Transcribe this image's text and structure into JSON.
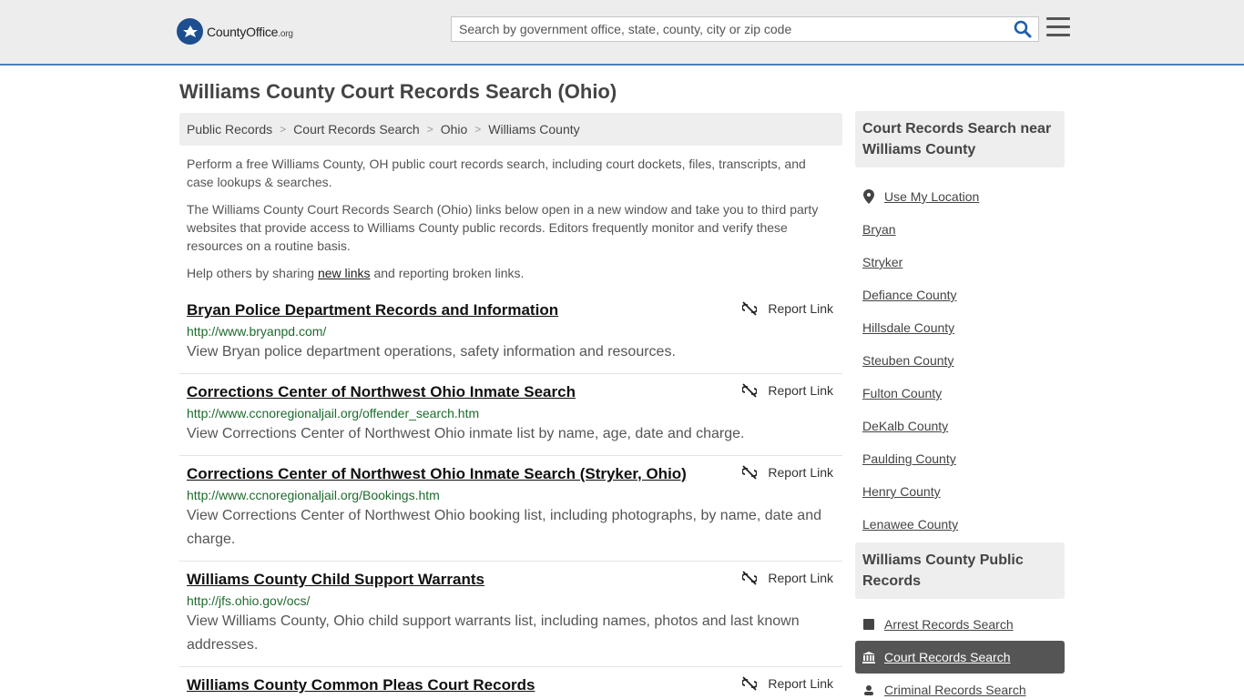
{
  "header": {
    "logo_text_main": "CountyOffice",
    "logo_text_org": ".org",
    "search_placeholder": "Search by government office, state, county, city or zip code"
  },
  "page_title": "Williams County Court Records Search (Ohio)",
  "breadcrumb": [
    {
      "label": "Public Records"
    },
    {
      "label": "Court Records Search"
    },
    {
      "label": "Ohio"
    },
    {
      "label": "Williams County"
    }
  ],
  "intro": {
    "p1": "Perform a free Williams County, OH public court records search, including court dockets, files, transcripts, and case lookups & searches.",
    "p2": "The Williams County Court Records Search (Ohio) links below open in a new window and take you to third party websites that provide access to Williams County public records. Editors frequently monitor and verify these resources on a routine basis.",
    "p3_before": "Help others by sharing ",
    "p3_link": "new links",
    "p3_after": " and reporting broken links."
  },
  "report_label": "Report Link",
  "listings": [
    {
      "title": "Bryan Police Department Records and Information",
      "url": "http://www.bryanpd.com/",
      "desc": "View Bryan police department operations, safety information and resources."
    },
    {
      "title": "Corrections Center of Northwest Ohio Inmate Search",
      "url": "http://www.ccnoregionaljail.org/offender_search.htm",
      "desc": "View Corrections Center of Northwest Ohio inmate list by name, age, date and charge."
    },
    {
      "title": "Corrections Center of Northwest Ohio Inmate Search (Stryker, Ohio)",
      "url": "http://www.ccnoregionaljail.org/Bookings.htm",
      "desc": "View Corrections Center of Northwest Ohio booking list, including photographs, by name, date and charge."
    },
    {
      "title": "Williams County Child Support Warrants",
      "url": "http://jfs.ohio.gov/ocs/",
      "desc": "View Williams County, Ohio child support warrants list, including names, photos and last known addresses."
    },
    {
      "title": "Williams County Common Pleas Court Records",
      "url": "",
      "desc": ""
    }
  ],
  "sidebar": {
    "nearby_heading": "Court Records Search near Williams County",
    "use_location": "Use My Location",
    "nearby": [
      "Bryan",
      "Stryker",
      "Defiance County",
      "Hillsdale County",
      "Steuben County",
      "Fulton County",
      "DeKalb County",
      "Paulding County",
      "Henry County",
      "Lenawee County"
    ],
    "records_heading": "Williams County Public Records",
    "records": [
      {
        "label": "Arrest Records Search",
        "icon": "square-icon"
      },
      {
        "label": "Court Records Search",
        "icon": "courthouse-icon",
        "active": true
      },
      {
        "label": "Criminal Records Search",
        "icon": "criminal-icon"
      }
    ]
  },
  "colors": {
    "accent_border": "#4a7dbf",
    "url_green": "#1e6b2e",
    "active_bg": "#555555"
  }
}
